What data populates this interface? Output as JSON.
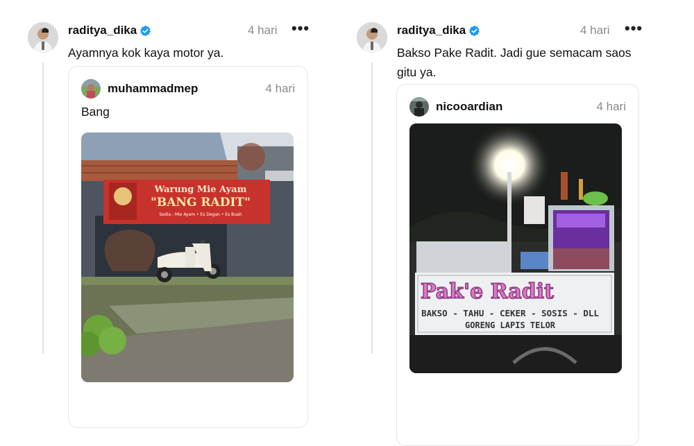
{
  "threads": [
    {
      "author": "raditya_dika",
      "time": "4 hari",
      "more": "•••",
      "text": "Ayamnya kok kaya motor ya.",
      "quote": {
        "author": "muhammadmep",
        "time": "4 hari",
        "text": "Bang",
        "sign_line1": "Warung Mie Ayam",
        "sign_line2": "\"BANG RADIT\"",
        "sign_line3": "Sedia : Mie Ayam • Es Degan • Es Buah"
      }
    },
    {
      "author": "raditya_dika",
      "time": "4 hari",
      "more": "•••",
      "text_line1": "Bakso Pake Radit. Jadi gue semacam saos",
      "text_line2": "gitu ya.",
      "quote": {
        "author": "nicooardian",
        "time": "4 hari",
        "cart_title": "Pak'e Radit",
        "cart_line1": "BAKSO - TAHU - CEKER - SOSIS - DLL",
        "cart_line2": "GORENG LAPIS TELOR"
      }
    }
  ],
  "colors": {
    "verified": "#1d9bf0",
    "muted_text": "#8a8a8a",
    "border": "#e5e5e5",
    "banner_red": "#c8322c"
  }
}
